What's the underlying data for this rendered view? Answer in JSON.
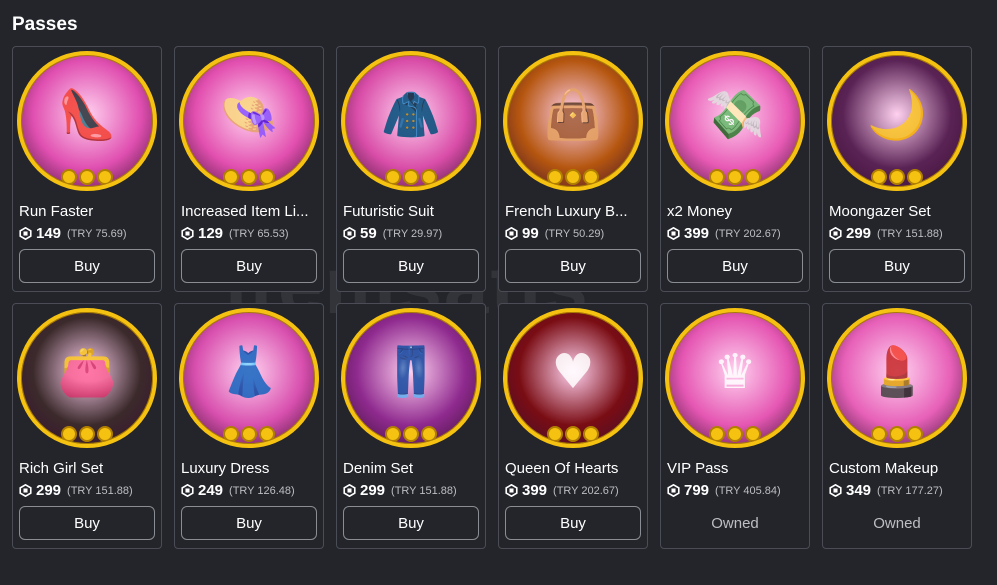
{
  "section_title": "Passes",
  "buy_label": "Buy",
  "owned_label": "Owned",
  "watermark": "itemsatis",
  "passes": [
    {
      "name": "Run Faster",
      "price": "149",
      "local_price": "(TRY 75.69)",
      "owned": false,
      "icon": "high-heel-icon",
      "bg": "#e04fb0",
      "glyph": "👠"
    },
    {
      "name": "Increased Item Li...",
      "price": "129",
      "local_price": "(TRY 65.53)",
      "owned": false,
      "icon": "hat-shirt-icon",
      "bg": "#e24faf",
      "glyph": "👒"
    },
    {
      "name": "Futuristic Suit",
      "price": "59",
      "local_price": "(TRY 29.97)",
      "owned": false,
      "icon": "suit-icon",
      "bg": "#d94da8",
      "glyph": "🧥"
    },
    {
      "name": "French Luxury B...",
      "price": "99",
      "local_price": "(TRY 50.29)",
      "owned": false,
      "icon": "handbag-icon",
      "bg": "#b5560f",
      "glyph": "👜"
    },
    {
      "name": "x2 Money",
      "price": "399",
      "local_price": "(TRY 202.67)",
      "owned": false,
      "icon": "money-icon",
      "bg": "#e85ab5",
      "glyph": "💸"
    },
    {
      "name": "Moongazer Set",
      "price": "299",
      "local_price": "(TRY 151.88)",
      "owned": false,
      "icon": "moon-outfit-icon",
      "bg": "#5a2355",
      "glyph": "🌙"
    },
    {
      "name": "Rich Girl Set",
      "price": "299",
      "local_price": "(TRY 151.88)",
      "owned": false,
      "icon": "rich-outfit-icon",
      "bg": "#3b2a2c",
      "glyph": "👛"
    },
    {
      "name": "Luxury Dress",
      "price": "249",
      "local_price": "(TRY 126.48)",
      "owned": false,
      "icon": "dress-icon",
      "bg": "#d84fae",
      "glyph": "👗"
    },
    {
      "name": "Denim Set",
      "price": "299",
      "local_price": "(TRY 151.88)",
      "owned": false,
      "icon": "denim-outfit-icon",
      "bg": "#8f2a8f",
      "glyph": "👖"
    },
    {
      "name": "Queen Of Hearts",
      "price": "399",
      "local_price": "(TRY 202.67)",
      "owned": false,
      "icon": "heart-outfit-icon",
      "bg": "#7a0d14",
      "glyph": "♥"
    },
    {
      "name": "VIP Pass",
      "price": "799",
      "local_price": "(TRY 405.84)",
      "owned": true,
      "icon": "vip-crown-icon",
      "bg": "#e557b3",
      "glyph": "♛"
    },
    {
      "name": "Custom Makeup",
      "price": "349",
      "local_price": "(TRY 177.27)",
      "owned": true,
      "icon": "makeup-face-icon",
      "bg": "#e760b8",
      "glyph": "💄"
    }
  ]
}
